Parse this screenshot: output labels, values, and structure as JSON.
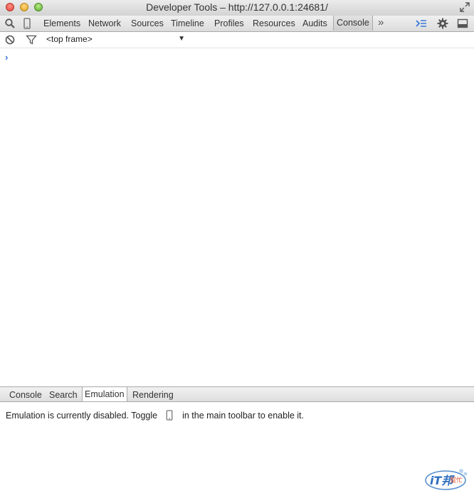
{
  "window": {
    "title": "Developer Tools – http://127.0.0.1:24681/"
  },
  "toolbar": {
    "tabs": [
      {
        "label": "Elements"
      },
      {
        "label": "Network"
      },
      {
        "label": "Sources"
      },
      {
        "label": "Timeline"
      },
      {
        "label": "Profiles"
      },
      {
        "label": "Resources"
      },
      {
        "label": "Audits"
      },
      {
        "label": "Console",
        "active": true
      }
    ],
    "overflow_label": "»",
    "icons": [
      "search-icon",
      "device-mode-icon",
      "drawer-toggle-icon",
      "gear-icon",
      "dock-icon"
    ]
  },
  "filterbar": {
    "frame_select_value": "<top frame>",
    "icons": [
      "clear-console-icon",
      "filter-icon"
    ]
  },
  "console": {
    "prompt_symbol": "›"
  },
  "drawer": {
    "tabs": [
      {
        "label": "Console"
      },
      {
        "label": "Search"
      },
      {
        "label": "Emulation",
        "active": true
      },
      {
        "label": "Rendering"
      }
    ],
    "message_before": "Emulation is currently disabled. Toggle",
    "message_after": "in the main toolbar to enable it."
  },
  "watermark": {
    "brand": "iT邦",
    "brand_sub": "幫忙"
  },
  "colors": {
    "accent_blue": "#2f73d8",
    "toolbar_border": "#a9a9a9"
  }
}
